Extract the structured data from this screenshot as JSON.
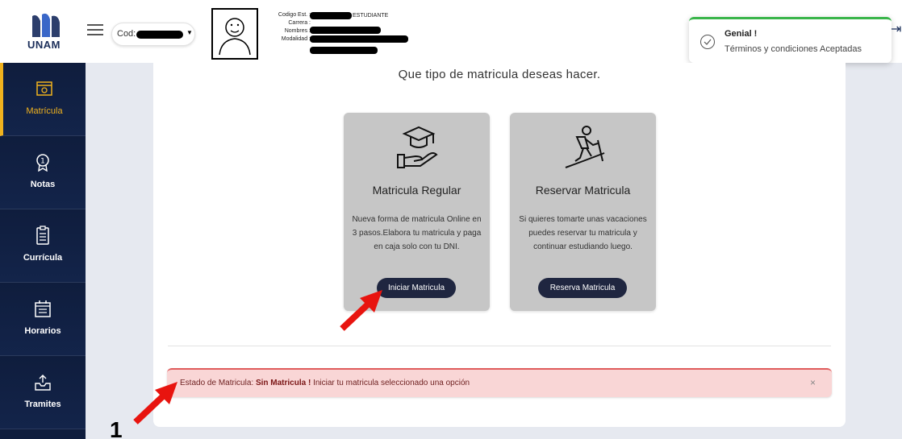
{
  "header": {
    "logo_text": "UNAM",
    "cod_label": "Cod:",
    "info_labels": [
      "Codigo Est. :",
      "Carrera :",
      "Nombres :",
      "Modalidad :"
    ],
    "role": "ESTUDIANTE"
  },
  "toast": {
    "title": "Genial !",
    "message": "Términos y condiciones Aceptadas"
  },
  "sidebar": {
    "items": [
      {
        "label": "Matrícula",
        "icon": "wallet-icon",
        "active": true
      },
      {
        "label": "Notas",
        "icon": "medal-icon"
      },
      {
        "label": "Currícula",
        "icon": "clipboard-icon"
      },
      {
        "label": "Horarios",
        "icon": "calendar-icon"
      },
      {
        "label": "Tramites",
        "icon": "inbox-upload-icon"
      }
    ]
  },
  "main": {
    "heading": "Que tipo de matricula deseas hacer.",
    "cards": [
      {
        "title": "Matricula Regular",
        "desc": "Nueva forma de matricula Online en 3 pasos.Elabora tu matricula y paga en caja solo con tu DNI.",
        "button": "Iniciar Matricula",
        "icon": "graduation-hand-icon"
      },
      {
        "title": "Reservar Matricula",
        "desc": "Si quieres tomarte unas vacaciones puedes reservar tu matricula y continuar estudiando luego.",
        "button": "Reserva Matricula",
        "icon": "hiker-icon"
      }
    ],
    "alert": {
      "prefix": "Estado de Matricula: ",
      "status": "Sin Matricula !",
      "suffix": " Iniciar tu matricula seleccionado una opción",
      "close": "×"
    }
  },
  "annotation": {
    "number": "1"
  },
  "colors": {
    "sidebar_bg": "#0f1d3d",
    "active_accent": "#f0b21e",
    "card_bg": "#c6c6c6",
    "button_bg": "#1f2640",
    "alert_bg": "#f9d6d6",
    "annotation_arrow": "#e8140f"
  }
}
